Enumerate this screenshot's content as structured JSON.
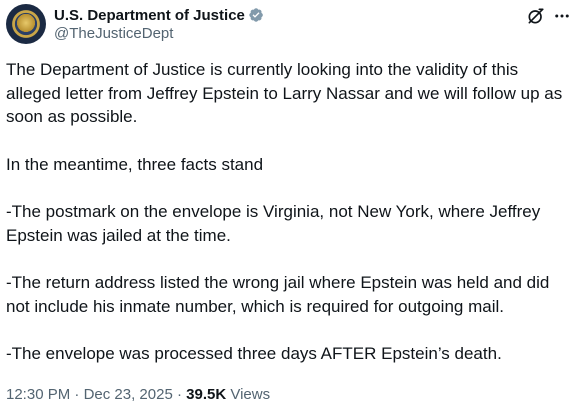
{
  "author": {
    "display_name": "U.S. Department of Justice",
    "handle": "@TheJusticeDept",
    "avatar_icon": "doj-seal-icon",
    "verified_icon": "verified-badge-icon",
    "verified_color": "#829aab"
  },
  "header_actions": {
    "grok_icon": "grok-icon",
    "more_icon": "more-icon"
  },
  "post": {
    "paragraphs": [
      "The Department of Justice is currently looking into the validity of this alleged letter from Jeffrey Epstein to Larry Nassar and we will follow up as soon as possible.",
      "In the meantime, three facts stand",
      "-The postmark on the envelope is Virginia, not New York, where Jeffrey Epstein was jailed at the time.",
      "-The return address listed the wrong jail where Epstein was held and did not include his inmate number, which is required for outgoing mail.",
      "-The envelope was processed three days AFTER Epstein’s death."
    ]
  },
  "meta": {
    "time": "12:30 PM",
    "separator": " · ",
    "date": "Dec 23, 2025",
    "views_count": "39.5K",
    "views_label": " Views"
  },
  "colors": {
    "text_primary": "#0f1419",
    "text_secondary": "#536471",
    "background": "#ffffff"
  }
}
